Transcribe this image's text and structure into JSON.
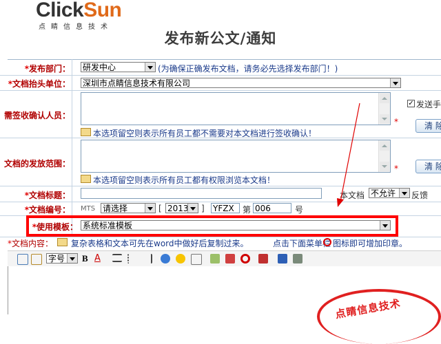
{
  "logo": {
    "word_a": "Click",
    "word_b": "Sun",
    "subtitle": "点睛信息技术"
  },
  "page_title": "发布新公文/通知",
  "fields": {
    "department": {
      "label": "发布部门：",
      "value": "研发中心",
      "hint": "(为确保正确发布文档，请务必先选择发布部门！)"
    },
    "header_unit": {
      "label": "文档抬头单位：",
      "value": "深圳市点睛信息技术有限公司"
    },
    "signers": {
      "label": "需签收确认人员：",
      "hint": "本选项留空则表示所有员工都不需要对本文档进行签收确认！",
      "send_label": "发送手",
      "clear_label": "清 除"
    },
    "scope": {
      "label": "文档的发放范围：",
      "hint": "本选项留空则表示所有员工都有权限浏览本文档！",
      "clear_label": "清 除"
    },
    "doc_title": {
      "label": "文档标题：",
      "doc_text": "本文档",
      "permission": "不允许",
      "feedback": "反馈"
    },
    "doc_number": {
      "label": "文档编号：",
      "prefix": "MTS",
      "select_value": "请选择",
      "bracket_l": "[",
      "year": "2013",
      "bracket_r": "]",
      "code": "YFZX",
      "di": "第",
      "num": "006",
      "hao": "号"
    },
    "template": {
      "label": "使用模板：",
      "value": "系统标准模板"
    },
    "content": {
      "label": "文档内容：",
      "hint": "复杂表格和文本可先在word中做好后复制过来。",
      "hint2": "点击下面菜单栏",
      "hint3": "图标即可增加印章。"
    }
  },
  "toolbar": {
    "font_size": "字号"
  },
  "stamp_text": "点睛信息技术"
}
